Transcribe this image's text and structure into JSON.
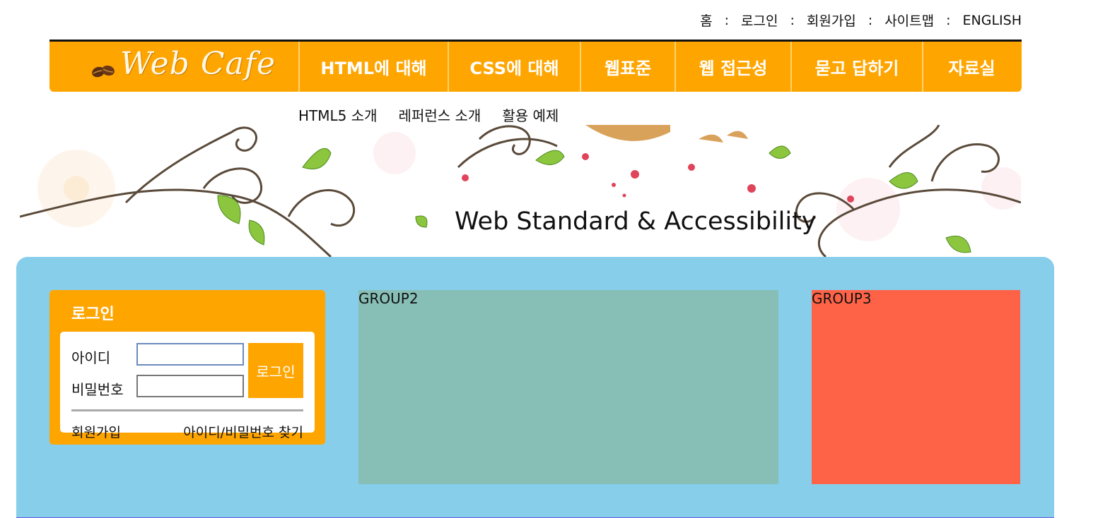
{
  "util_menu": {
    "items": [
      "홈",
      "로그인",
      "회원가입",
      "사이트맵",
      "ENGLISH"
    ],
    "separator": ":"
  },
  "logo": {
    "text": "Web Cafe"
  },
  "nav": {
    "items": [
      {
        "label": "HTML에 대해"
      },
      {
        "label": "CSS에 대해"
      },
      {
        "label": "웹표준"
      },
      {
        "label": "웹 접근성"
      },
      {
        "label": "묻고 답하기"
      },
      {
        "label": "자료실"
      }
    ]
  },
  "submenu": {
    "items": [
      "HTML5 소개",
      "레퍼런스 소개",
      "활용 예제"
    ]
  },
  "banner": {
    "title": "Web Standard & Accessibility"
  },
  "login": {
    "title": "로그인",
    "id_label": "아이디",
    "pw_label": "비밀번호",
    "id_value": "",
    "pw_value": "",
    "button_label": "로그인",
    "join_link": "회원가입",
    "find_link": "아이디/비밀번호 찾기"
  },
  "groups": {
    "group2": "GROUP2",
    "group3": "GROUP3"
  },
  "colors": {
    "accent": "#ffa500",
    "content_bg": "#87ceeb",
    "group2": "#87bfb7",
    "group3": "#ff6347"
  }
}
